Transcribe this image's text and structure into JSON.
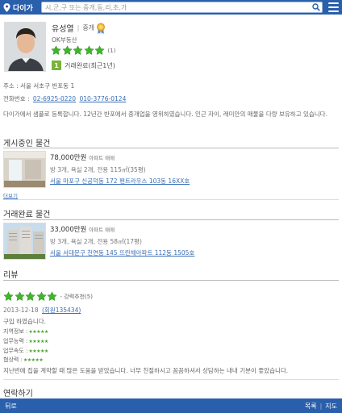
{
  "header": {
    "logo_text": "다이가",
    "search_placeholder": "시,군,구 또는 중개,동,리,초,가",
    "accent": "#2a5fab"
  },
  "profile": {
    "name": "유성열",
    "role": "중개",
    "company": "OK부동산",
    "rating_count": "(1)",
    "deal_badge": "1",
    "deal_text": "거래완료(최근1년)",
    "address": "주소 : 서울 서초구 반포동 1",
    "phone_label": "전화번호 :",
    "phone1": "02-6925-0220",
    "phone2": "010-3776-0124",
    "intro": "다이가에서 샘플로 등록합니다. 12년간 반포에서 중개업을 영위하였습니다. 인근 자이, 래미안의 매물을 다량 보유하고 있습니다."
  },
  "selling": {
    "title": "게시중인 물건",
    "item": {
      "price": "78,000만원",
      "type": "아파트 매매",
      "spec": "방 3개, 욕실 2개, 전용 115㎡(35평)",
      "location": "서울 마포구 신공덕동 172 펜트라우스 103동 16XX호"
    },
    "more": "더보기"
  },
  "completed": {
    "title": "거래완료 물건",
    "item": {
      "price": "33,000만원",
      "type": "아파트 매매",
      "spec": "방 3개, 욕실 2개, 전용 58㎡(17평)",
      "location": "서울 서대문구 천연동 145 뜨란채아파트 112동 1505호"
    }
  },
  "review": {
    "title": "리뷰",
    "recommend": "- 강력추천(5)",
    "date": "2013-12-18",
    "member": "(회원135434)",
    "headline": "구입 하였습니다.",
    "scores": [
      {
        "label": "지역정보 :",
        "stars": "★★★★★"
      },
      {
        "label": "업무능력 :",
        "stars": "★★★★★"
      },
      {
        "label": "업무속도 :",
        "stars": "★★★★★"
      },
      {
        "label": "협상력 :",
        "stars": "★★★★★"
      }
    ],
    "body": "지난번에 집을 계약할 때 많은 도움을 받았습니다. 너무 친절하시고 꼼꼼하셔서 상담하는 내내 기분이 좋았습니다."
  },
  "contact": {
    "title": "연락하기"
  },
  "footer": {
    "back": "뒤로",
    "list": "목록",
    "map": "지도"
  },
  "colors": {
    "star_green": "#3fb52b",
    "link": "#3a6fb7",
    "badge_green": "#7ab33a"
  }
}
